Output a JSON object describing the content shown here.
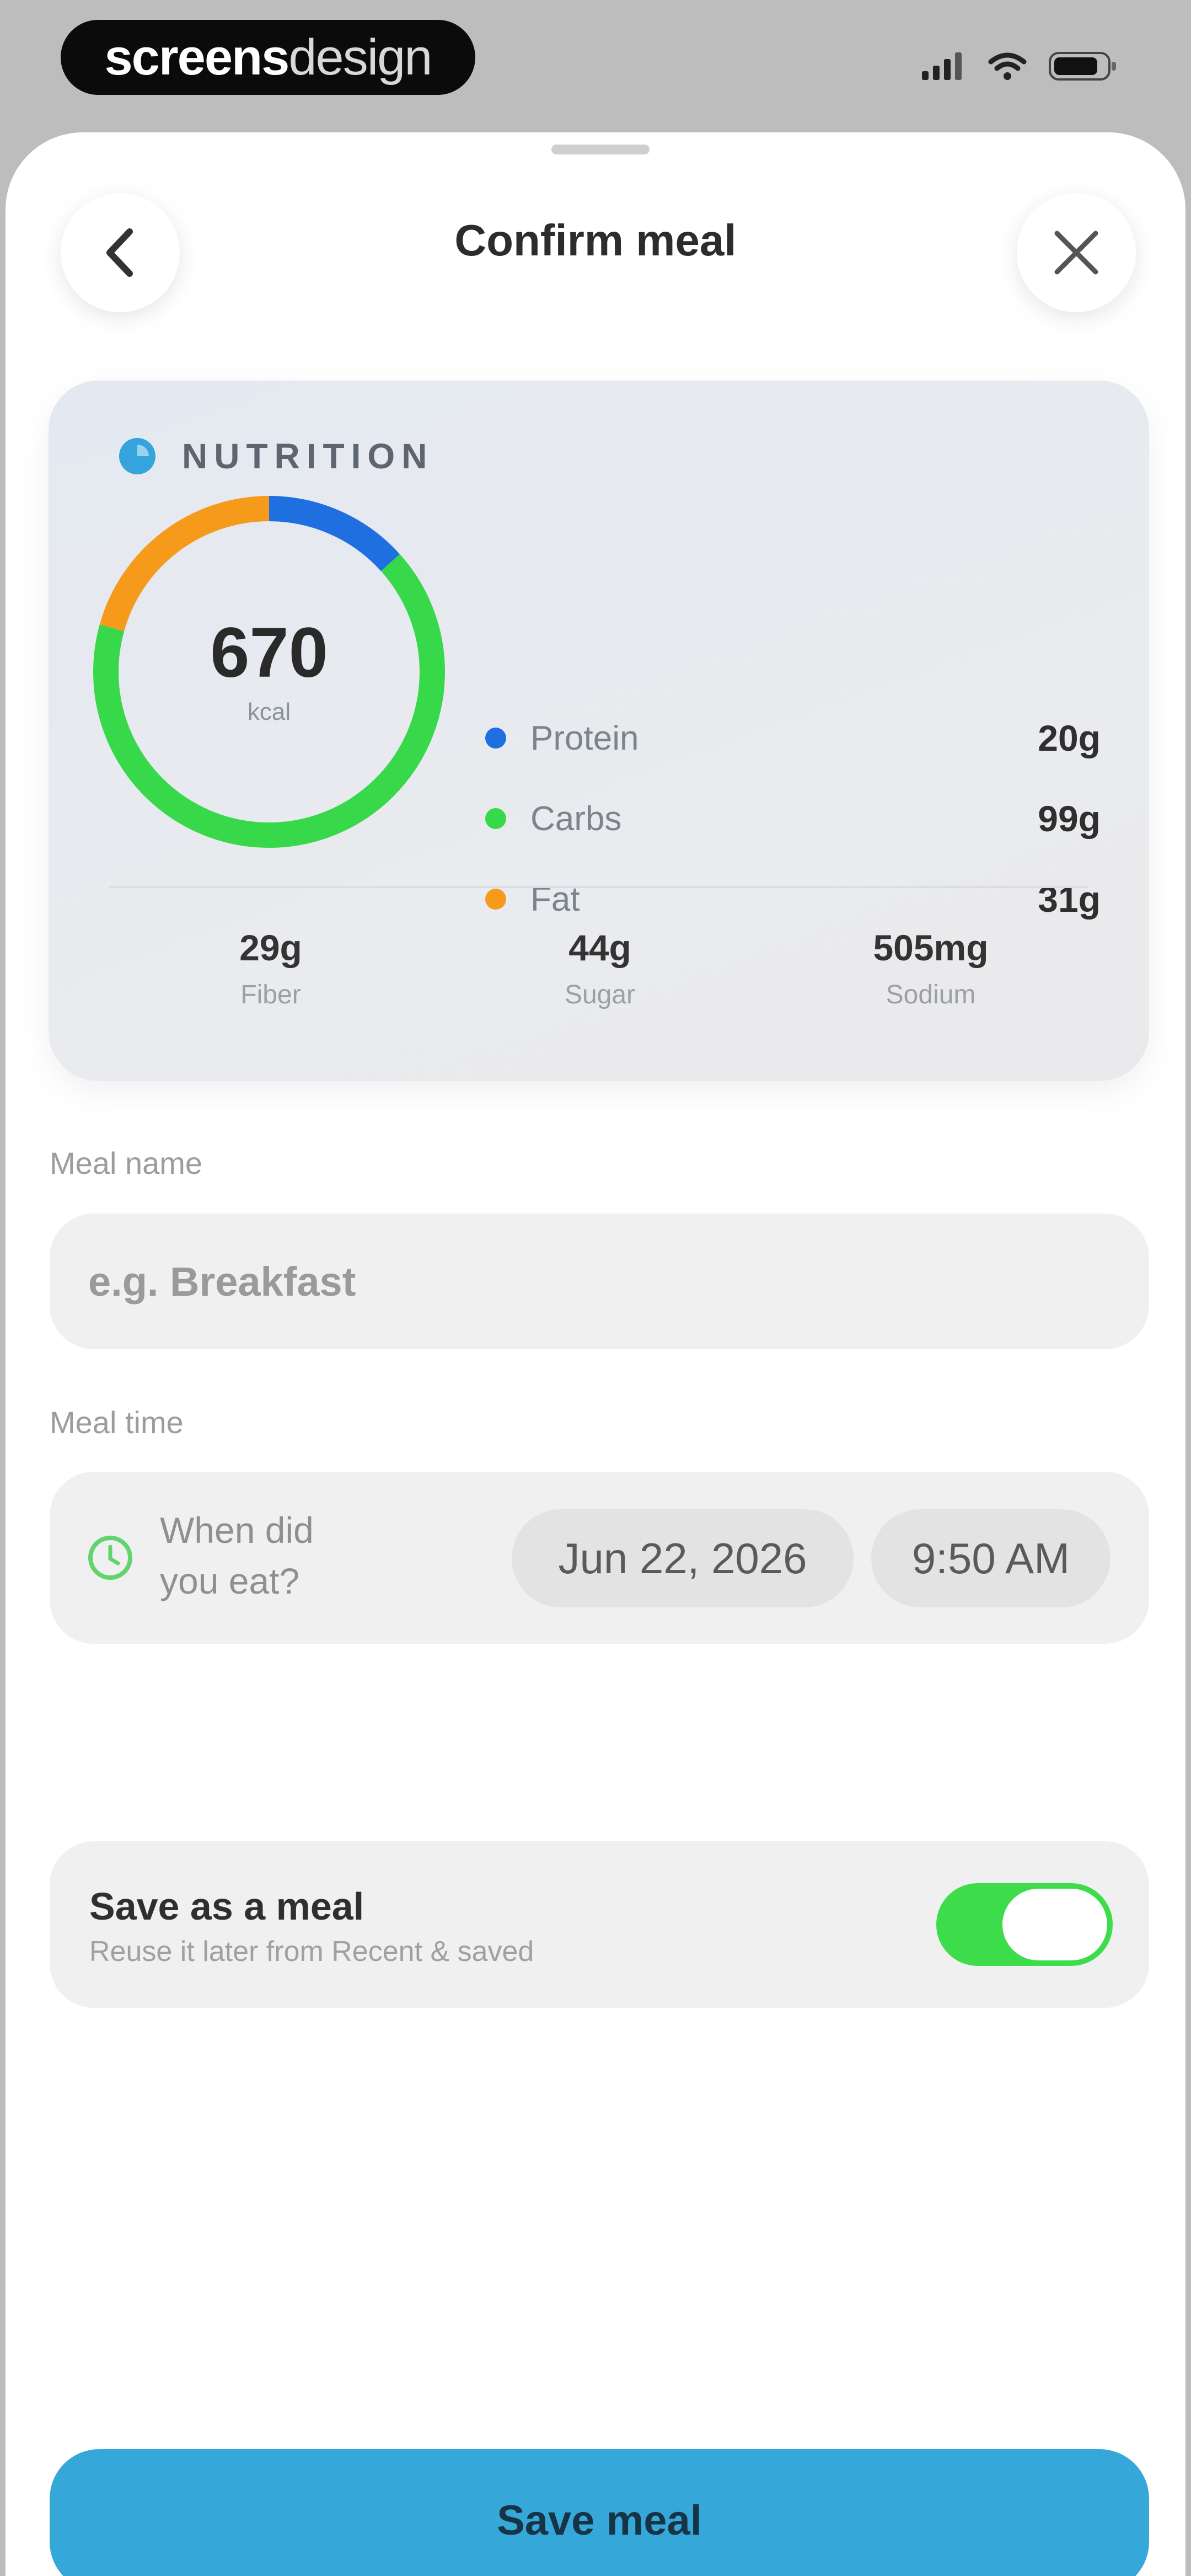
{
  "status_bar": {
    "brand_bold": "screens",
    "brand_light": "design"
  },
  "header": {
    "title": "Confirm meal",
    "back_icon": "chevron-left-icon",
    "close_icon": "close-icon"
  },
  "nutrition": {
    "label": "NUTRITION",
    "calories": "670",
    "calories_unit": "kcal",
    "macros": [
      {
        "name": "Protein",
        "value": "20g",
        "grams": 20,
        "color": "#1f6fe0"
      },
      {
        "name": "Carbs",
        "value": "99g",
        "grams": 99,
        "color": "#37d84a"
      },
      {
        "name": "Fat",
        "value": "31g",
        "grams": 31,
        "color": "#f59a1b"
      }
    ],
    "micros": [
      {
        "value": "29g",
        "label": "Fiber"
      },
      {
        "value": "44g",
        "label": "Sugar"
      },
      {
        "value": "505mg",
        "label": "Sodium"
      }
    ]
  },
  "meal_name": {
    "label": "Meal name",
    "placeholder": "e.g. Breakfast",
    "value": ""
  },
  "meal_time": {
    "label": "Meal time",
    "prompt": "When did you eat?",
    "date": "Jun 22, 2026",
    "time": "9:50 AM"
  },
  "save_as_meal": {
    "title": "Save as a meal",
    "subtitle": "Reuse it later from Recent & saved",
    "enabled": true
  },
  "save_button": {
    "label": "Save meal"
  },
  "colors": {
    "accent": "#35a7d8",
    "toggle_on": "#3ddc4b"
  }
}
